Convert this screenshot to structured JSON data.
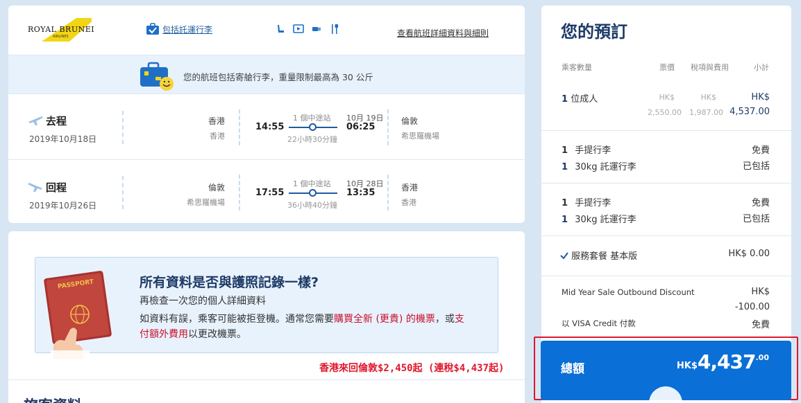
{
  "header": {
    "airline_logo_text": "ROYAL BRUNEI",
    "airline_logo_sub": "AIRLINES",
    "baggage_link": "包括託運行李",
    "details_link": "查看航班詳細資料與細則"
  },
  "baggage_banner": {
    "text": "您的航班包括寄艙行李，重量限制最高為 30 公斤"
  },
  "outbound": {
    "label": "去程",
    "date": "2019年10月18日",
    "from_city": "香港",
    "from_airport": "香港",
    "depart_time": "14:55",
    "stops": "1 個中途站",
    "duration": "22小時30分鐘",
    "arrive_date": "10月 19日",
    "arrive_time": "06:25",
    "to_city": "倫敦",
    "to_airport": "希思羅機場"
  },
  "inbound": {
    "label": "回程",
    "date": "2019年10月26日",
    "from_city": "倫敦",
    "from_airport": "希思羅機場",
    "depart_time": "17:55",
    "stops": "1 個中途站",
    "duration": "36小時40分鐘",
    "arrive_date": "10月 28日",
    "arrive_time": "13:35",
    "to_city": "香港",
    "to_airport": "香港"
  },
  "passport_notice": {
    "passport_word": "PASSPORT",
    "title": "所有資料是否與護照記錄一樣?",
    "subtitle": "再檢查一次您的個人詳細資料",
    "body_1": "如資料有誤，乘客可能被拒登機。通常您需要",
    "body_link_1": "購買全新 (更貴) 的機票",
    "body_2": "，或",
    "body_link_2": "支付額外費用",
    "body_3": "以更改機票。"
  },
  "promo_caption": "香港來回倫敦$2,450起 (連稅$4,437起)",
  "section_partial_title": "旅客資料",
  "summary": {
    "title": "您的預訂",
    "col_passengers": "乘客數量",
    "col_fare": "票價",
    "col_taxes": "稅項與費用",
    "col_subtotal": "小計",
    "adult_count": "1",
    "adult_label": "位成人",
    "fare_currency": "HK$",
    "fare_value": "2,550.00",
    "tax_currency": "HK$",
    "tax_value": "1,987.00",
    "subtotal_currency": "HK$",
    "subtotal_value": "4,537.00",
    "bag_groups": [
      {
        "hand_count": "1",
        "hand_label": "手提行李",
        "hand_price": "免費",
        "checked_count": "1",
        "checked_label": "30kg 託運行李",
        "checked_price": "已包括"
      },
      {
        "hand_count": "1",
        "hand_label": "手提行李",
        "hand_price": "免費",
        "checked_count": "1",
        "checked_label": "30kg 託運行李",
        "checked_price": "已包括"
      }
    ],
    "service_label": "服務套餐 基本版",
    "service_price": "HK$ 0.00",
    "discount_label": "Mid Year Sale Outbound Discount",
    "discount_currency": "HK$",
    "discount_value": "-100.00",
    "visa_label": "以 VISA Credit 付款",
    "visa_value": "免費",
    "total_label": "總額",
    "total_currency": "HK$",
    "total_value": "4,437",
    "total_cents": ".00"
  },
  "colors": {
    "accent_blue": "#0a6fd6",
    "highlight_red": "#e0162b",
    "green": "#1aa34a",
    "navy": "#1d3a66"
  },
  "icons": [
    "suitcase-check-icon",
    "seat-icon",
    "screen-icon",
    "power-icon",
    "meal-icon",
    "plane-depart-icon",
    "plane-return-icon",
    "checkmark-icon",
    "passport-icon"
  ]
}
